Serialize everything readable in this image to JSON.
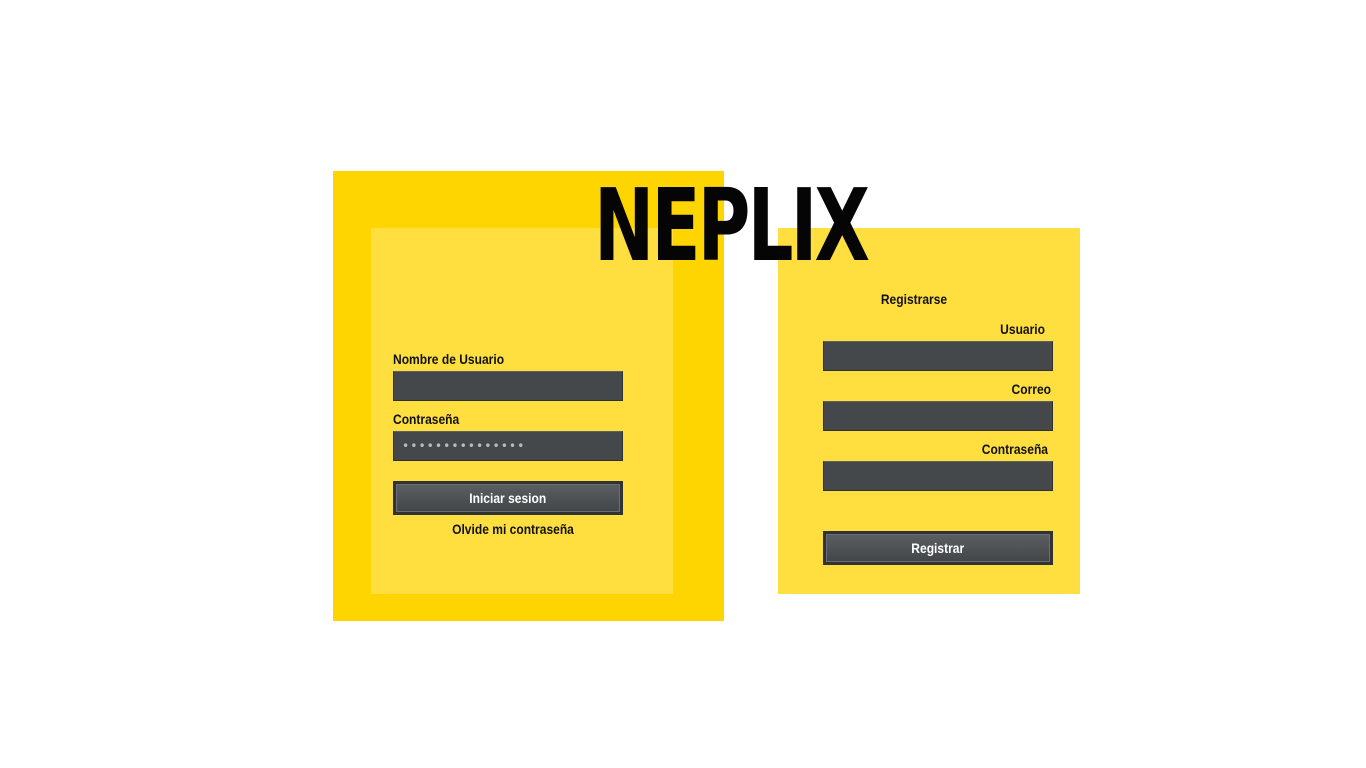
{
  "brand": {
    "logo": "NEPLIX"
  },
  "login": {
    "username_label": "Nombre de Usuario",
    "username_value": "",
    "password_label": "Contraseña",
    "password_value": "•••••••••••••••",
    "submit_label": "Iniciar sesion",
    "forgot_label": "Olvide mi contraseña"
  },
  "register": {
    "title": "Registrarse",
    "user_label": "Usuario",
    "user_value": "",
    "email_label": "Correo",
    "email_value": "",
    "password_label": "Contraseña",
    "password_value": "",
    "submit_label": "Registrar"
  },
  "colors": {
    "panel_outer": "#FFD500",
    "panel_inner": "#FFDF3F",
    "field_bg": "#45484a",
    "logo": "#050505"
  }
}
